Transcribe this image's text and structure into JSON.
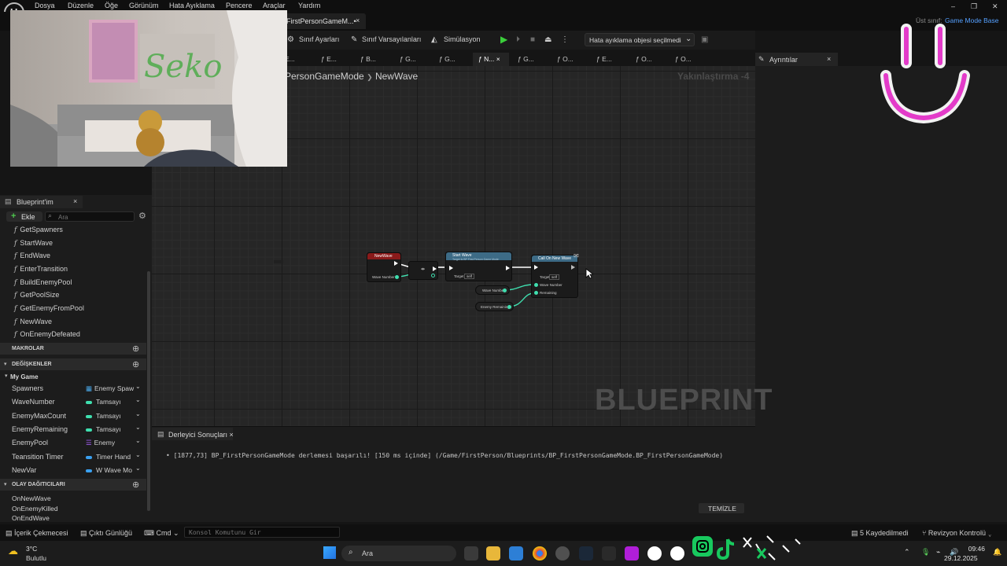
{
  "menu": [
    "Dosya",
    "Düzenle",
    "Öğe",
    "Görünüm",
    "Hata Ayıklama",
    "Pencere",
    "Araçlar",
    "Yardım"
  ],
  "doc_tab": {
    "label": "FirstPersonGameM...•",
    "close": "×"
  },
  "parent_class": {
    "label": "Üst sınıf:",
    "value": "Game Mode Base"
  },
  "window_controls": [
    "–",
    "❐",
    "✕"
  ],
  "toolbar": {
    "class_settings": "Sınıf Ayarları",
    "class_defaults": "Sınıf Varsayılanları",
    "simulation": "Simülasyon",
    "debug_object": "Hata ayıklama objesi seçilmedi"
  },
  "function_tabs": [
    "E...",
    "E...",
    "B...",
    "G...",
    "G...",
    "N...",
    "G...",
    "O...",
    "E...",
    "O...",
    "O..."
  ],
  "details": {
    "label": "Ayrıntılar",
    "close": "×"
  },
  "graph": {
    "breadcrumb_root": "PersonGameMode",
    "breadcrumb_sep": "❯",
    "breadcrumb_current": "NewWave",
    "zoom": "Yakınlaştırma -4",
    "watermark": "BLUEPRINT",
    "nodes": {
      "event": {
        "title": "NewWave",
        "pin": "Wave Number"
      },
      "start_wave": {
        "title": "Start Wave",
        "subtitle": "Target is BP First Person Game Mode",
        "pin": "Target",
        "self": "self"
      },
      "call_on_new_wave": {
        "title": "Call On New Wave",
        "pin_target": "Target",
        "self": "self",
        "pin_wave": "Wave Number",
        "pin_remaining": "Remaining"
      },
      "get_wave_number": {
        "label": "Wave Number"
      },
      "get_enemy_remaining": {
        "label": "Enemy Remaining"
      }
    }
  },
  "my_blueprint": {
    "tab_label": "Blueprint'im",
    "tab_close": "×",
    "add_label": "Ekle",
    "search_placeholder": "Ara",
    "functions": [
      "GetSpawners",
      "StartWave",
      "EndWave",
      "EnterTransition",
      "BuildEnemyPool",
      "GetPoolSize",
      "GetEnemyFromPool",
      "NewWave",
      "OnEnemyDefeated"
    ],
    "macros_label": "MAKROLAR",
    "variables_label": "DEĞİŞKENLER",
    "category": "My Game",
    "variables": [
      {
        "name": "Spawners",
        "type": "Enemy Spaw",
        "color": "#4aa8e8"
      },
      {
        "name": "WaveNumber",
        "type": "Tamsayı",
        "color": "#3fdfaf"
      },
      {
        "name": "EnemyMaxCount",
        "type": "Tamsayı",
        "color": "#3fdfaf"
      },
      {
        "name": "EnemyRemaining",
        "type": "Tamsayı",
        "color": "#3fdfaf"
      },
      {
        "name": "EnemyPool",
        "type": "Enemy",
        "color": "#9b59e8"
      },
      {
        "name": "Teansition Timer",
        "type": "Timer Hand",
        "color": "#3aa0f0"
      },
      {
        "name": "NewVar",
        "type": "W Wave Mo",
        "color": "#3aa0f0"
      }
    ],
    "dispatchers_label": "OLAY DAĞITICILARI",
    "dispatchers": [
      "OnNewWave",
      "OnEnemyKilled",
      "OnEndWave"
    ]
  },
  "compiler": {
    "tab_label": "Derleyici Sonuçları",
    "tab_close": "×",
    "log": "[1877,73] BP_FirstPersonGameMode derlemesi başarılı! [150 ms içinde] (/Game/FirstPerson/Blueprints/BP_FirstPersonGameMode.BP_FirstPersonGameMode)",
    "clear": "TEMİZLE"
  },
  "statusbar": {
    "content_drawer": "İçerik Çekmecesi",
    "output_log": "Çıktı Günlüğü",
    "cmd": "Cmd",
    "console_placeholder": "Konsol Komutunu Gir",
    "unsaved": "5 Kaydedilmedi",
    "revision": "Revizyon Kontrolü"
  },
  "taskbar": {
    "temperature": "3°C",
    "weather": "Bulutlu",
    "search": "Ara",
    "time": "09:46",
    "date": "29.12.2025"
  },
  "webcam": {
    "wall_text": "Seko"
  }
}
